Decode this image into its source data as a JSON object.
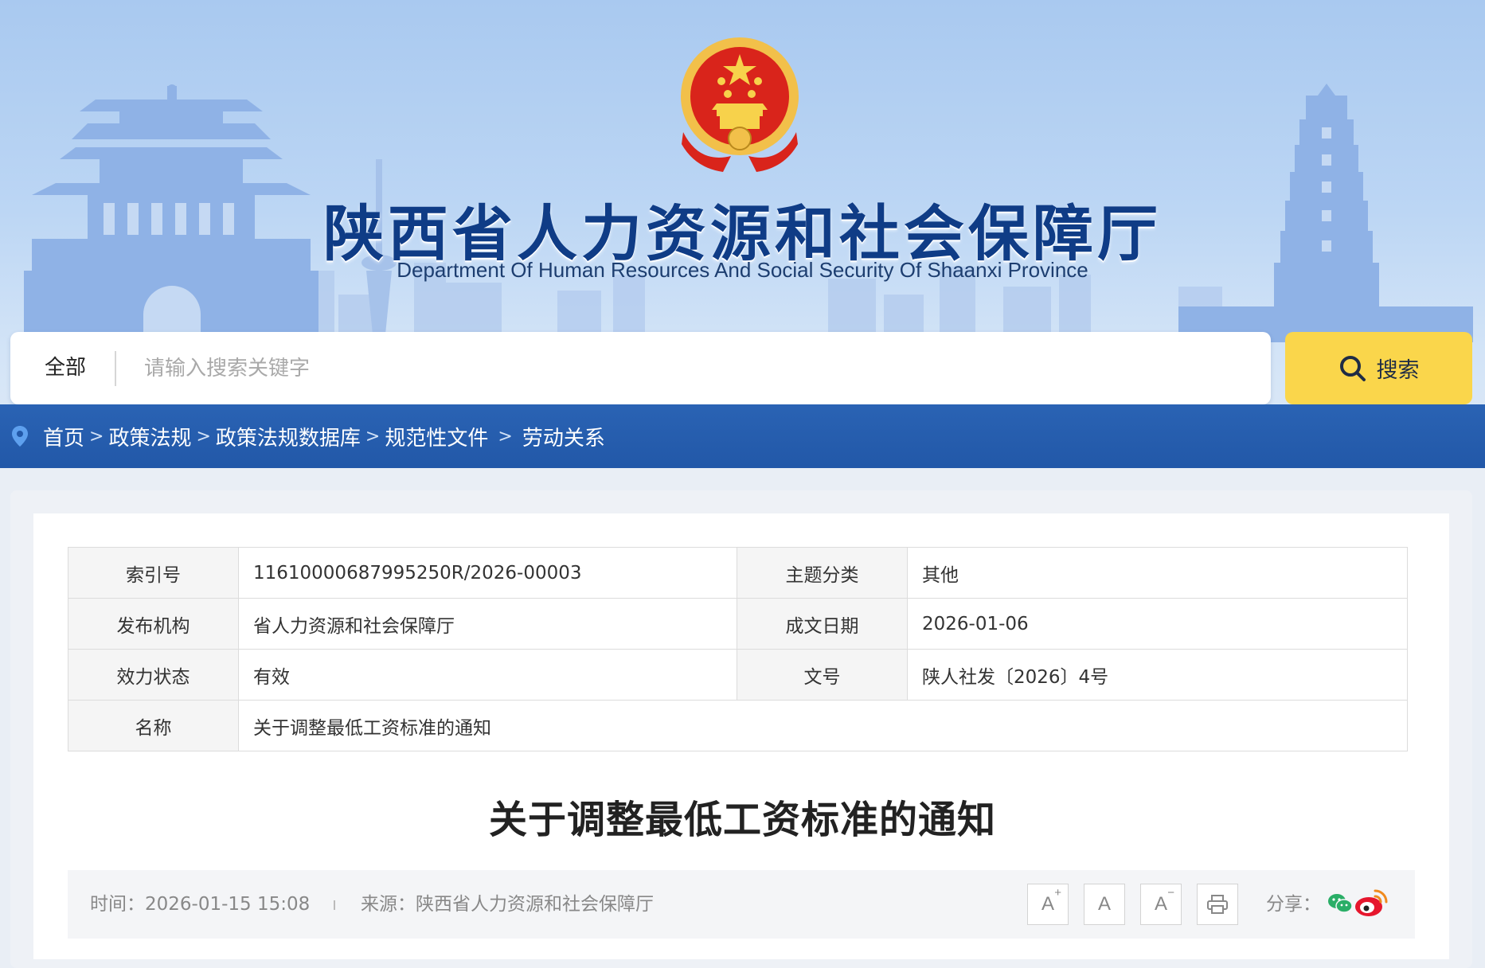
{
  "header": {
    "title": "陕西省人力资源和社会保障厅",
    "subtitle": "Department Of Human Resources And Social Security Of Shaanxi Province",
    "emblem_icon": "national-emblem"
  },
  "search": {
    "scope": "全部",
    "placeholder": "请输入搜索关键字",
    "button_label": "搜索",
    "button_color": "#fad64b"
  },
  "breadcrumb": {
    "items": [
      "首页",
      "政策法规",
      "政策法规数据库",
      "规范性文件"
    ],
    "current": "劳动关系",
    "separator": ">"
  },
  "meta": {
    "index_label": "索引号",
    "index_value": "11610000687995250R/2026-00003",
    "topic_label": "主题分类",
    "topic_value": "其他",
    "publisher_label": "发布机构",
    "publisher_value": "省人力资源和社会保障厅",
    "date_label": "成文日期",
    "date_value": "2026-01-06",
    "status_label": "效力状态",
    "status_value": "有效",
    "docno_label": "文号",
    "docno_value": "陕人社发〔2026〕4号",
    "name_label": "名称",
    "name_value": "关于调整最低工资标准的通知"
  },
  "article": {
    "title": "关于调整最低工资标准的通知",
    "time": "时间：2026-01-15 15:08",
    "source": "来源：陕西省人力资源和社会保障厅",
    "font_large": "A",
    "font_large_mark": "+",
    "font_normal": "A",
    "font_small": "A",
    "font_small_mark": "−",
    "share_label": "分享："
  },
  "colors": {
    "title_blue": "#0f3c86",
    "crumb_blue": "#2258a8",
    "wechat_green": "#2aae67",
    "weibo_red": "#e6162d"
  }
}
